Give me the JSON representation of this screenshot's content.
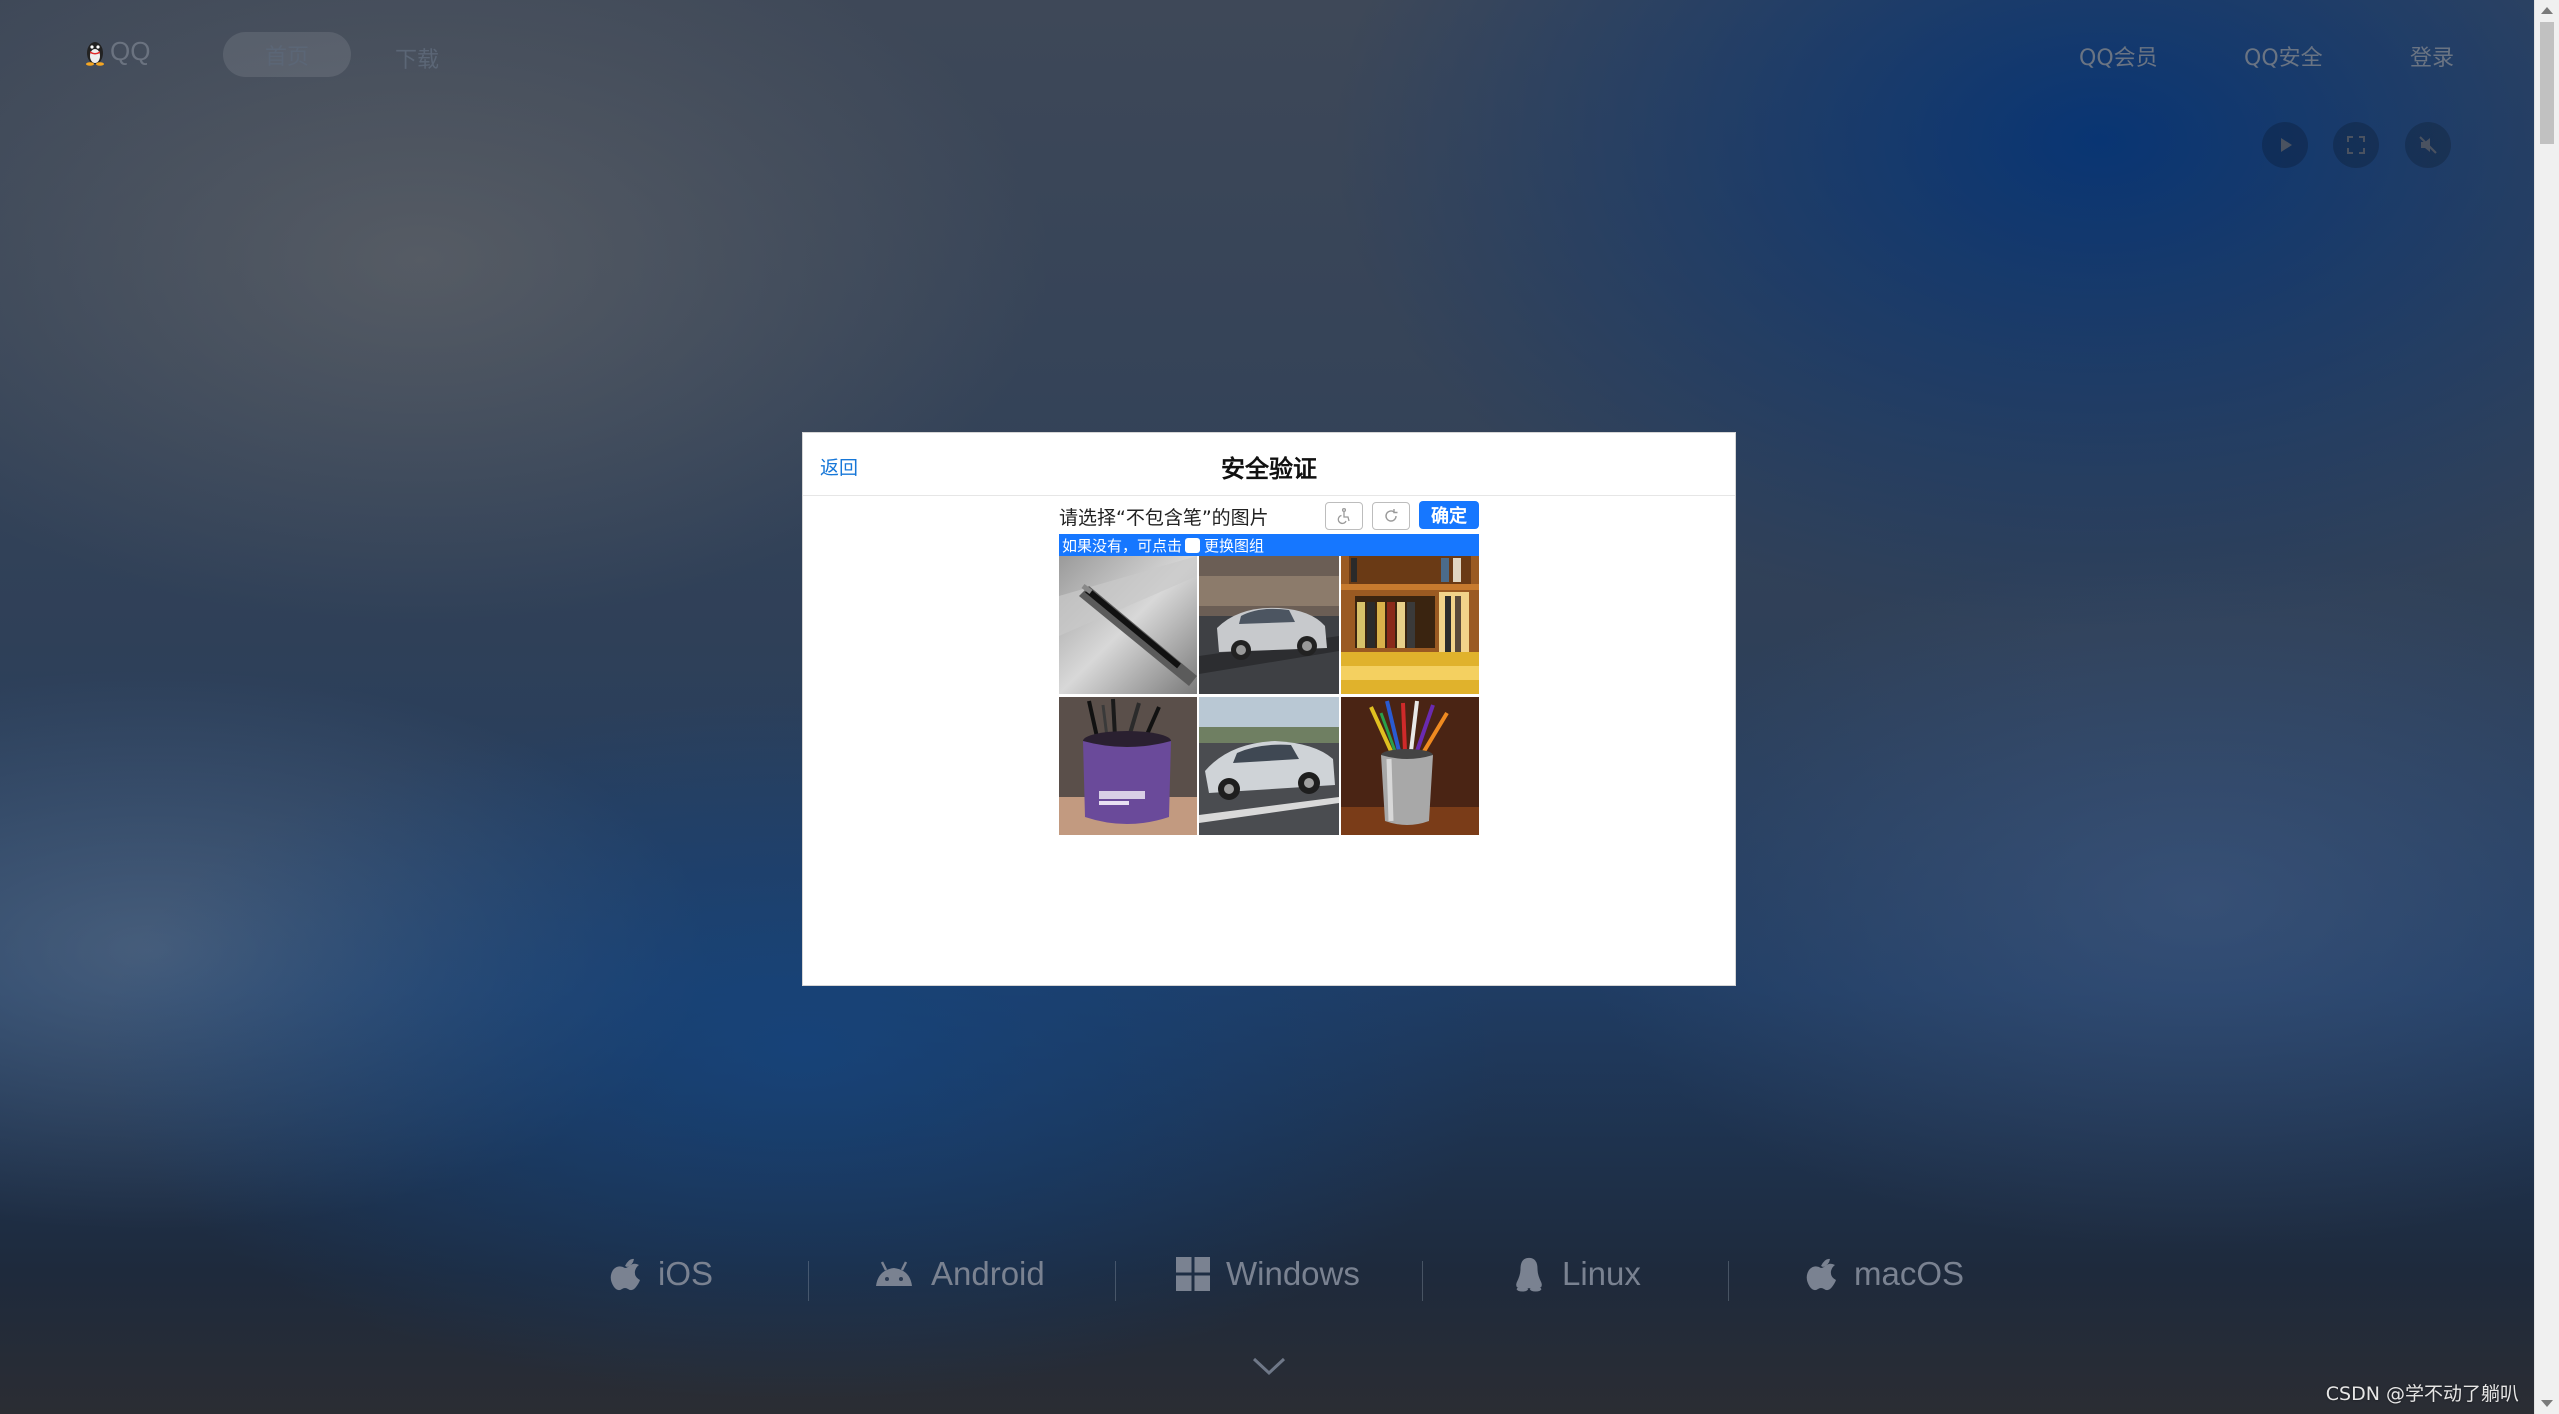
{
  "nav": {
    "logo_text": "QQ",
    "logo_icon": "qq-penguin-icon",
    "home": "首页",
    "download": "下载",
    "member": "QQ会员",
    "security": "QQ安全",
    "login": "登录"
  },
  "media_controls": {
    "play_icon": "play-icon",
    "fullscreen_icon": "fullscreen-icon",
    "mute_icon": "mute-icon"
  },
  "dialog": {
    "back": "返回",
    "title": "安全验证",
    "prompt": "请选择“不包含笔”的图片",
    "accessibility_icon": "accessibility-icon",
    "refresh_icon": "refresh-icon",
    "confirm": "确定",
    "hint_before": "如果没有，可点击",
    "hint_after": "更换图组",
    "images": [
      {
        "name": "notebook-with-pen"
      },
      {
        "name": "silver-car-parked"
      },
      {
        "name": "bookshelf-with-books"
      },
      {
        "name": "pens-in-purple-holder"
      },
      {
        "name": "silver-car-on-road"
      },
      {
        "name": "colored-pencils-in-cup"
      }
    ],
    "colors": {
      "accent": "#1677ff",
      "link": "#1677d8"
    }
  },
  "platforms": [
    {
      "label": "iOS",
      "icon": "apple-icon"
    },
    {
      "label": "Android",
      "icon": "android-icon"
    },
    {
      "label": "Windows",
      "icon": "windows-icon"
    },
    {
      "label": "Linux",
      "icon": "linux-penguin-icon"
    },
    {
      "label": "macOS",
      "icon": "apple-icon"
    }
  ],
  "watermark": "CSDN @学不动了躺叭"
}
